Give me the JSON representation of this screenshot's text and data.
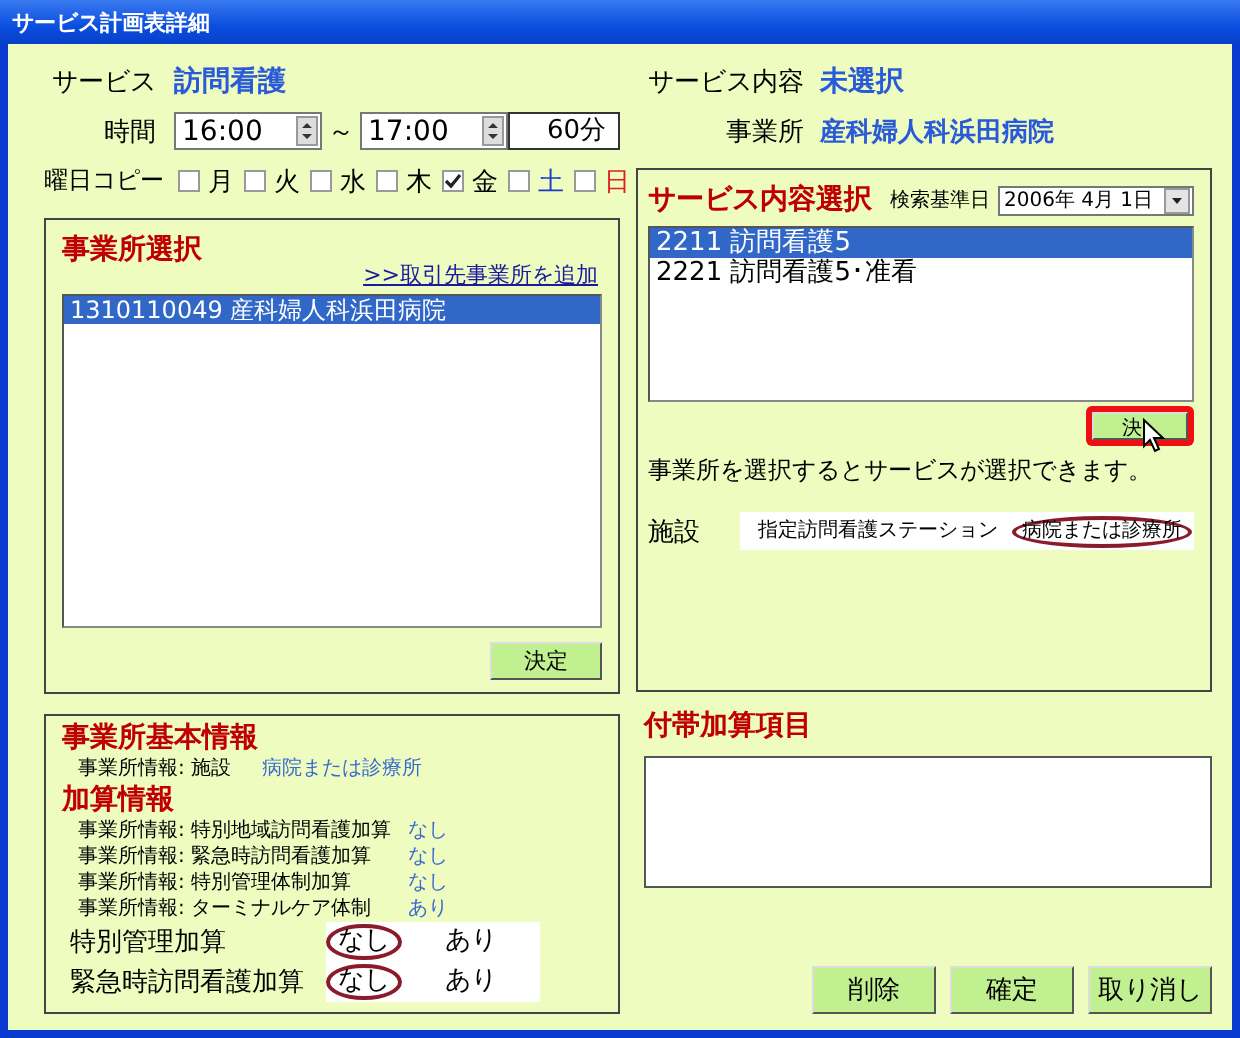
{
  "window": {
    "title": "サービス計画表詳細"
  },
  "service": {
    "label": "サービス",
    "value": "訪問看護"
  },
  "time": {
    "label": "時間",
    "start": "16:00",
    "separator": "～",
    "end": "17:00",
    "duration": "60分"
  },
  "day_copy": {
    "label": "曜日コピー",
    "days": [
      {
        "label": "月",
        "checked": false,
        "color": "#000000"
      },
      {
        "label": "火",
        "checked": false,
        "color": "#000000"
      },
      {
        "label": "水",
        "checked": false,
        "color": "#000000"
      },
      {
        "label": "木",
        "checked": false,
        "color": "#000000"
      },
      {
        "label": "金",
        "checked": true,
        "color": "#000000"
      },
      {
        "label": "土",
        "checked": false,
        "color": "#1a3cc8"
      },
      {
        "label": "日",
        "checked": false,
        "color": "#e02020"
      }
    ]
  },
  "office_select": {
    "title": "事業所選択",
    "link": ">>取引先事業所を追加",
    "items": [
      {
        "text": "1310110049 産科婦人科浜田病院",
        "selected": true
      }
    ],
    "button": "決定"
  },
  "office_info": {
    "title": "事業所基本情報",
    "facility_label": "事業所情報: 施設",
    "facility_value": "病院または診療所",
    "addon_title": "加算情報",
    "addons": [
      {
        "label": "事業所情報: 特別地域訪問看護加算",
        "value": "なし"
      },
      {
        "label": "事業所情報: 緊急時訪問看護加算",
        "value": "なし"
      },
      {
        "label": "事業所情報: 特別管理体制加算",
        "value": "なし"
      },
      {
        "label": "事業所情報: ターミナルケア体制",
        "value": "あり"
      }
    ],
    "options": [
      {
        "label": "特別管理加算",
        "choices": [
          {
            "text": "なし",
            "selected": true
          },
          {
            "text": "あり",
            "selected": false
          }
        ]
      },
      {
        "label": "緊急時訪問看護加算",
        "choices": [
          {
            "text": "なし",
            "selected": true
          },
          {
            "text": "あり",
            "selected": false
          }
        ]
      }
    ]
  },
  "service_content": {
    "label": "サービス内容",
    "value": "未選択"
  },
  "office": {
    "label": "事業所",
    "value": "産科婦人科浜田病院"
  },
  "service_select": {
    "title": "サービス内容選択",
    "date_label": "検索基準日",
    "date": "2006年 4月 1日",
    "items": [
      {
        "text": "2211 訪問看護5",
        "selected": true
      },
      {
        "text": "2221 訪問看護5･准看",
        "selected": false
      }
    ],
    "button": "決",
    "button_highlighted": true,
    "message": "事業所を選択するとサービスが選択できます。",
    "facility_label": "施設",
    "facility_choices": [
      {
        "text": "指定訪問看護ステーション",
        "selected": false
      },
      {
        "text": "病院または診療所",
        "selected": true
      }
    ]
  },
  "extras": {
    "title": "付帯加算項目"
  },
  "buttons": [
    "削除",
    "確定",
    "取り消し"
  ]
}
